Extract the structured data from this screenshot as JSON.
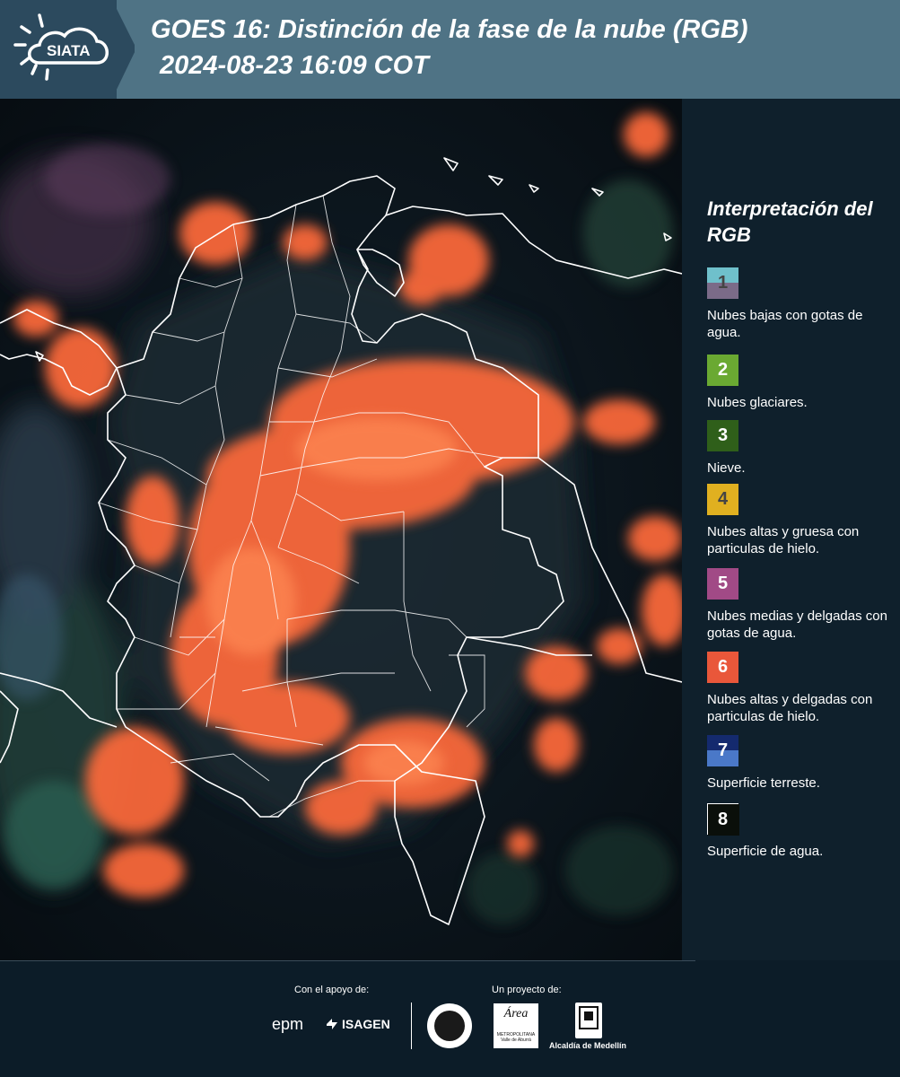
{
  "header": {
    "logo_text": "SIATA",
    "title": "GOES 16: Distinción de la fase de la nube (RGB)",
    "datetime": "2024-08-23 16:09 COT"
  },
  "legend": {
    "title": "Interpretación del RGB",
    "items": [
      {
        "number": "1",
        "text": "Nubes bajas con gotas de agua.",
        "color_top": "#6fc0cb",
        "color_bottom": "#7b6b88",
        "num_color": "#444444"
      },
      {
        "number": "2",
        "text": "Nubes glaciares.",
        "color_top": "#6aa932",
        "color_bottom": "#6aa932",
        "num_color": "#ffffff"
      },
      {
        "number": "3",
        "text": "Nieve.",
        "color_top": "#2f5f1a",
        "color_bottom": "#2f5f1a",
        "num_color": "#ffffff"
      },
      {
        "number": "4",
        "text": "Nubes altas y gruesa con particulas de hielo.",
        "color_top": "#e0b020",
        "color_bottom": "#e0b020",
        "num_color": "#444444"
      },
      {
        "number": "5",
        "text": "Nubes medias y delgadas con gotas de agua.",
        "color_top": "#a14a86",
        "color_bottom": "#a14a86",
        "num_color": "#ffffff"
      },
      {
        "number": "6",
        "text": "Nubes altas y delgadas con particulas de hielo.",
        "color_top": "#e9573a",
        "color_bottom": "#e9573a",
        "num_color": "#ffffff"
      },
      {
        "number": "7",
        "text": "Superficie terreste.",
        "color_top": "#142a6e",
        "color_bottom": "#4a78c8",
        "num_color": "#ffffff"
      },
      {
        "number": "8",
        "text": "Superficie de agua.",
        "color_top": "#0a0f0a",
        "color_bottom": "#0a0f0a",
        "num_color": "#ffffff"
      }
    ]
  },
  "footer": {
    "support_label": "Con el apoyo de:",
    "project_label": "Un proyecto de:",
    "sponsor_1": "epm",
    "sponsor_2": "ISAGEN",
    "partner_1_text": "Área",
    "partner_1_subtext": "METROPOLITANA Valle de Aburrá",
    "partner_2": "Alcaldía de Medellín"
  },
  "colors": {
    "header_dark": "#2c4a5e",
    "header_light": "#4f7385",
    "background": "#0c1c28",
    "cloud_orange": "#ff6a3a",
    "boundary": "#ffffff"
  }
}
